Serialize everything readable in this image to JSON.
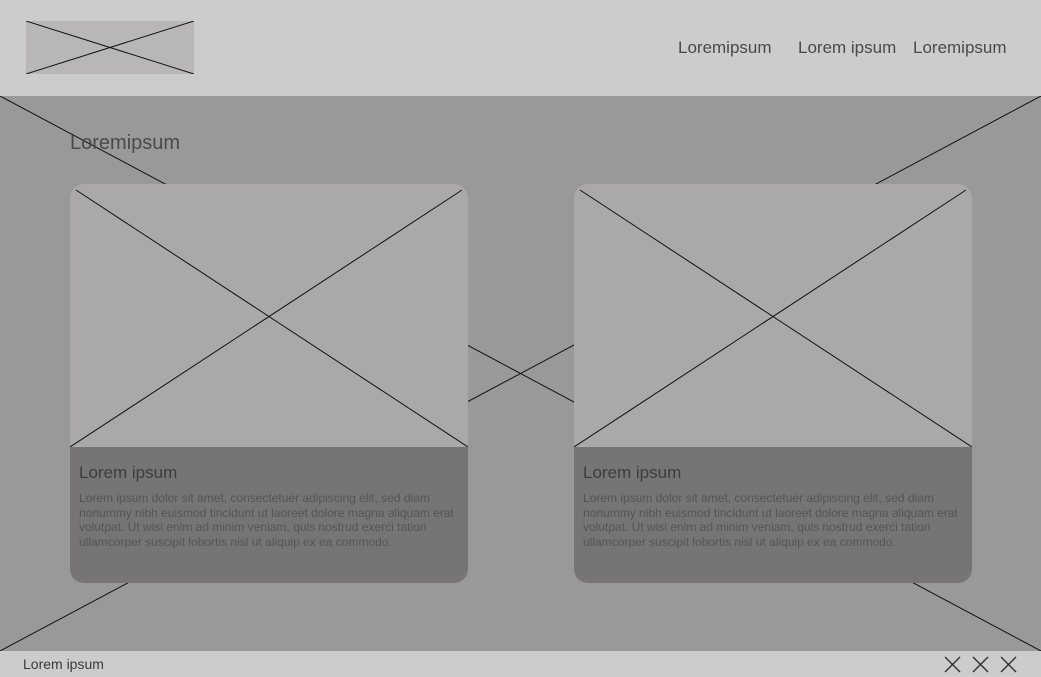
{
  "header": {
    "nav": [
      "Loremipsum",
      "Lorem ipsum",
      "Loremipsum"
    ]
  },
  "hero": {
    "title": "Loremipsum",
    "cards": [
      {
        "title": "Lorem ipsum",
        "text": "Lorem ipsum dolor sit amet, consectetuer adipiscing elit, sed diam nonummy nibh euismod tincidunt ut laoreet dolore magna aliquam erat volutpat. Ut wisi enim ad minim veniam, quis nostrud exerci tation ullamcorper suscipit lobortis nisl ut aliquip ex ea commodo."
      },
      {
        "title": "Lorem ipsum",
        "text": "Lorem ipsum dolor sit amet, consectetuer adipiscing elit, sed diam nonummy nibh euismod tincidunt ut laoreet dolore magna aliquam erat volutpat. Ut wisi enim ad minim veniam, quis nostrud exerci tation ullamcorper suscipit lobortis nisl ut aliquip ex ea commodo."
      }
    ]
  },
  "footer": {
    "text": "Lorem ipsum",
    "icons": [
      "placeholder-icon",
      "placeholder-icon",
      "placeholder-icon"
    ]
  }
}
